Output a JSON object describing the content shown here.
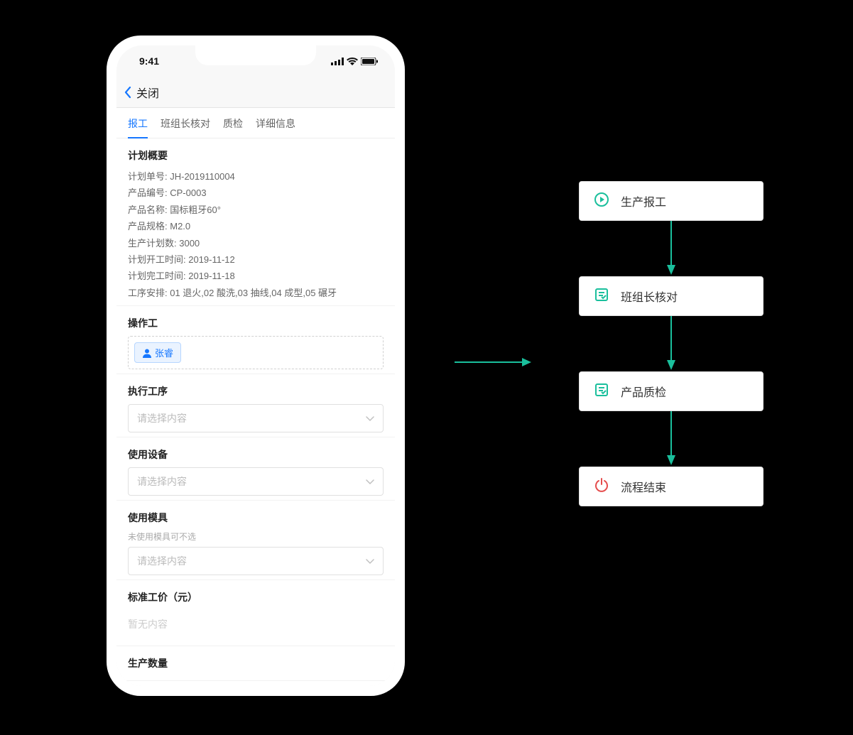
{
  "status": {
    "time": "9:41"
  },
  "header": {
    "close": "关闭"
  },
  "tabs": [
    {
      "label": "报工",
      "active": true
    },
    {
      "label": "班组长核对",
      "active": false
    },
    {
      "label": "质检",
      "active": false
    },
    {
      "label": "详细信息",
      "active": false
    }
  ],
  "plan": {
    "title": "计划概要",
    "fields": [
      {
        "label": "计划单号",
        "value": "JH-2019110004"
      },
      {
        "label": "产品编号",
        "value": "CP-0003"
      },
      {
        "label": "产品名称",
        "value": "国标粗牙60°"
      },
      {
        "label": "产品规格",
        "value": "M2.0"
      },
      {
        "label": "生产计划数",
        "value": "3000"
      },
      {
        "label": "计划开工时间",
        "value": "2019-11-12"
      },
      {
        "label": "计划完工时间",
        "value": "2019-11-18"
      },
      {
        "label": "工序安排",
        "value": "01 退火,02 酸洗,03 抽线,04 成型,05 碾牙"
      }
    ]
  },
  "operator": {
    "title": "操作工",
    "name": "张睿"
  },
  "process": {
    "title": "执行工序",
    "placeholder": "请选择内容"
  },
  "equipment": {
    "title": "使用设备",
    "placeholder": "请选择内容"
  },
  "mold": {
    "title": "使用模具",
    "hint": "未使用模具可不选",
    "placeholder": "请选择内容"
  },
  "price": {
    "title": "标准工价（元）",
    "placeholder": "暂无内容"
  },
  "quantity": {
    "title": "生产数量"
  },
  "flow": {
    "steps": [
      {
        "icon": "play",
        "label": "生产报工",
        "color": "#1abf9c"
      },
      {
        "icon": "form",
        "label": "班组长核对",
        "color": "#1abf9c"
      },
      {
        "icon": "form",
        "label": "产品质检",
        "color": "#1abf9c"
      },
      {
        "icon": "power",
        "label": "流程结束",
        "color": "#e54d4d"
      }
    ],
    "arrow_color": "#1abf9c"
  }
}
